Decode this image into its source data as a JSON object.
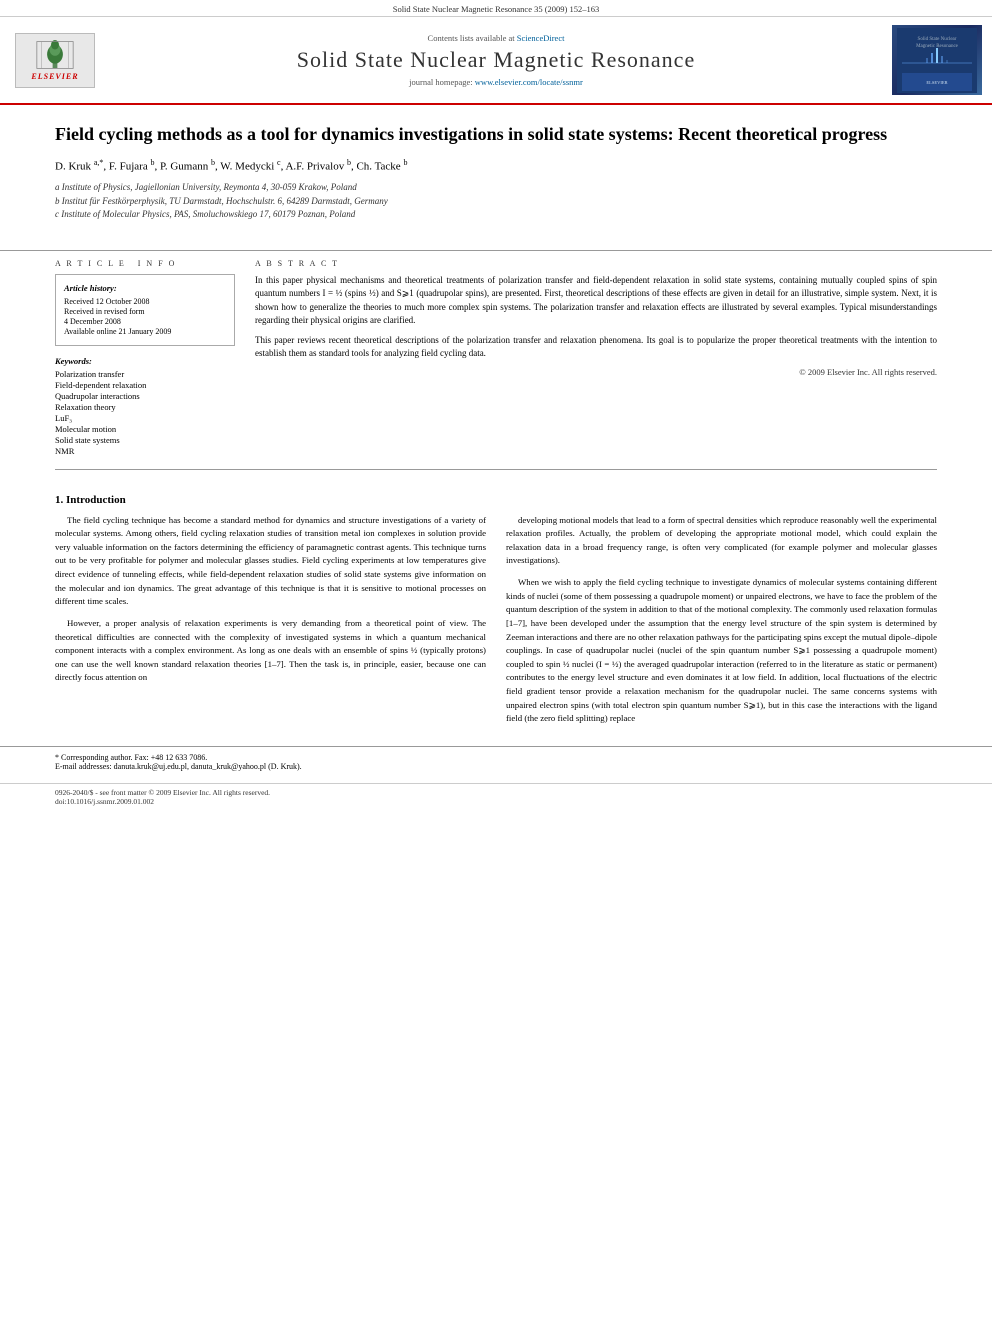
{
  "journal": {
    "top_bar": "Solid State Nuclear Magnetic Resonance 35 (2009) 152–163",
    "sciencedirect_text": "Contents lists available at",
    "sciencedirect_link": "ScienceDirect",
    "sciencedirect_url": "ScienceDirect",
    "title": "Solid  State  Nuclear  Magnetic  Resonance",
    "homepage_text": "journal homepage:",
    "homepage_url": "www.elsevier.com/locate/ssnmr",
    "elsevier_label": "ELSEVIER"
  },
  "article": {
    "title": "Field cycling methods as a tool for dynamics investigations in solid state systems: Recent theoretical progress",
    "authors": "D. Kruk a,*, F. Fujara b, P. Gumann b, W. Medycki c, A.F. Privalov b, Ch. Tacke b",
    "affiliations": [
      "a Institute of Physics, Jagiellonian University, Reymonta 4, 30-059 Krakow, Poland",
      "b Institut für Festkörperphysik, TU Darmstadt, Hochschulstr. 6, 64289 Darmstadt, Germany",
      "c Institute of Molecular Physics, PAS, Smoluchowskiego 17, 60179 Poznan, Poland"
    ],
    "article_info": {
      "label": "Article history:",
      "dates": [
        "Received 12 October 2008",
        "Received in revised form",
        "4 December 2008",
        "Available online 21 January 2009"
      ]
    },
    "keywords_label": "Keywords:",
    "keywords": [
      "Polarization transfer",
      "Field-dependent relaxation",
      "Quadrupolar interactions",
      "Relaxation theory",
      "LuF₃",
      "Molecular motion",
      "Solid state systems",
      "NMR"
    ],
    "abstract_heading": "A B S T R A C T",
    "abstract_paragraphs": [
      "In this paper physical mechanisms and theoretical treatments of polarization transfer and field-dependent relaxation in solid state systems, containing mutually coupled spins of spin quantum numbers I = ½ (spins ½) and S⩾1 (quadrupolar spins), are presented. First, theoretical descriptions of these effects are given in detail for an illustrative, simple system. Next, it is shown how to generalize the theories to much more complex spin systems. The polarization transfer and relaxation effects are illustrated by several examples. Typical misunderstandings regarding their physical origins are clarified.",
      "This paper reviews recent theoretical descriptions of the polarization transfer and relaxation phenomena. Its goal is to popularize the proper theoretical treatments with the intention to establish them as standard tools for analyzing field cycling data."
    ],
    "copyright": "© 2009 Elsevier Inc. All rights reserved.",
    "section1_title": "1.  Introduction",
    "intro_left": [
      "The field cycling technique has become a standard method for dynamics and structure investigations of a variety of molecular systems. Among others, field cycling relaxation studies of transition metal ion complexes in solution provide very valuable information on the factors determining the efficiency of paramagnetic contrast agents. This technique turns out to be very profitable for polymer and molecular glasses studies. Field cycling experiments at low temperatures give direct evidence of tunneling effects, while field-dependent relaxation studies of solid state systems give information on the molecular and ion dynamics. The great advantage of this technique is that it is sensitive to motional processes on different time scales.",
      "However, a proper analysis of relaxation experiments is very demanding from a theoretical point of view. The theoretical difficulties are connected with the complexity of investigated systems in which a quantum mechanical component interacts with a complex environment. As long as one deals with an ensemble of spins ½ (typically protons) one can use the well known standard relaxation theories [1–7]. Then the task is, in principle, easier, because one can directly focus attention on"
    ],
    "intro_right": [
      "developing motional models that lead to a form of spectral densities which reproduce reasonably well the experimental relaxation profiles. Actually, the problem of developing the appropriate motional model, which could explain the relaxation data in a broad frequency range, is often very complicated (for example polymer and molecular glasses investigations).",
      "When we wish to apply the field cycling technique to investigate dynamics of molecular systems containing different kinds of nuclei (some of them possessing a quadrupole moment) or unpaired electrons, we have to face the problem of the quantum description of the system in addition to that of the motional complexity. The commonly used relaxation formulas [1–7], have been developed under the assumption that the energy level structure of the spin system is determined by Zeeman interactions and there are no other relaxation pathways for the participating spins except the mutual dipole–dipole couplings. In case of quadrupolar nuclei (nuclei of the spin quantum number S⩾1 possessing a quadrupole moment) coupled to spin ½ nuclei (I = ½) the averaged quadrupolar interaction (referred to in the literature as static or permanent) contributes to the energy level structure and even dominates it at low field. In addition, local fluctuations of the electric field gradient tensor provide a relaxation mechanism for the quadrupolar nuclei. The same concerns systems with unpaired electron spins (with total electron spin quantum number S⩾1), but in this case the interactions with the ligand field (the zero field splitting) replace"
    ],
    "footnote": "* Corresponding author. Fax: +48 12 633 7086.",
    "email_note": "E-mail addresses: danuta.kruk@uj.edu.pl, danuta_kruk@yahoo.pl (D. Kruk).",
    "bottom_left": "0926-2040/$ - see front matter © 2009 Elsevier Inc. All rights reserved.",
    "bottom_doi": "doi:10.1016/j.ssnmr.2009.01.002"
  }
}
